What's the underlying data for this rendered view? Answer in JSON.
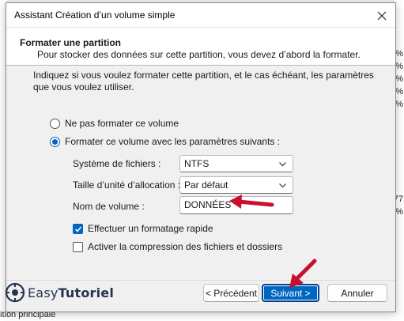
{
  "background": {
    "right_glyphs": [
      "%",
      "%",
      "%",
      "%",
      "%",
      "77",
      "%"
    ],
    "bottom_text": "ition principale"
  },
  "window": {
    "title": "Assistant Création d’un volume simple",
    "close_icon": "close-icon"
  },
  "header": {
    "title": "Formater une partition",
    "subtitle": "Pour stocker des données sur cette partition, vous devez d’abord la formater."
  },
  "body": {
    "intro": "Indiquez si vous voulez formater cette partition, et le cas échéant, les paramètres que vous voulez utiliser.",
    "option_no_format": "Ne pas formater ce volume",
    "option_format": "Formater ce volume avec les paramètres suivants :",
    "selected_option": "format",
    "filesystem_label": "Système de fichiers :",
    "filesystem_value": "NTFS",
    "allocation_label": "Taille d’unité d’allocation :",
    "allocation_value": "Par défaut",
    "volume_name_label": "Nom de volume :",
    "volume_name_value": "DONNÉES",
    "quick_format_label": "Effectuer un formatage rapide",
    "quick_format_checked": true,
    "compression_label": "Activer la compression des fichiers et dossiers",
    "compression_checked": false
  },
  "footer": {
    "back_label": "< Précédent",
    "next_label": "Suivant >",
    "cancel_label": "Annuler"
  },
  "watermark": {
    "prefix": "Easy",
    "suffix": "Tutoriel"
  },
  "colors": {
    "accent": "#0067c0",
    "arrow": "#c8102e"
  }
}
